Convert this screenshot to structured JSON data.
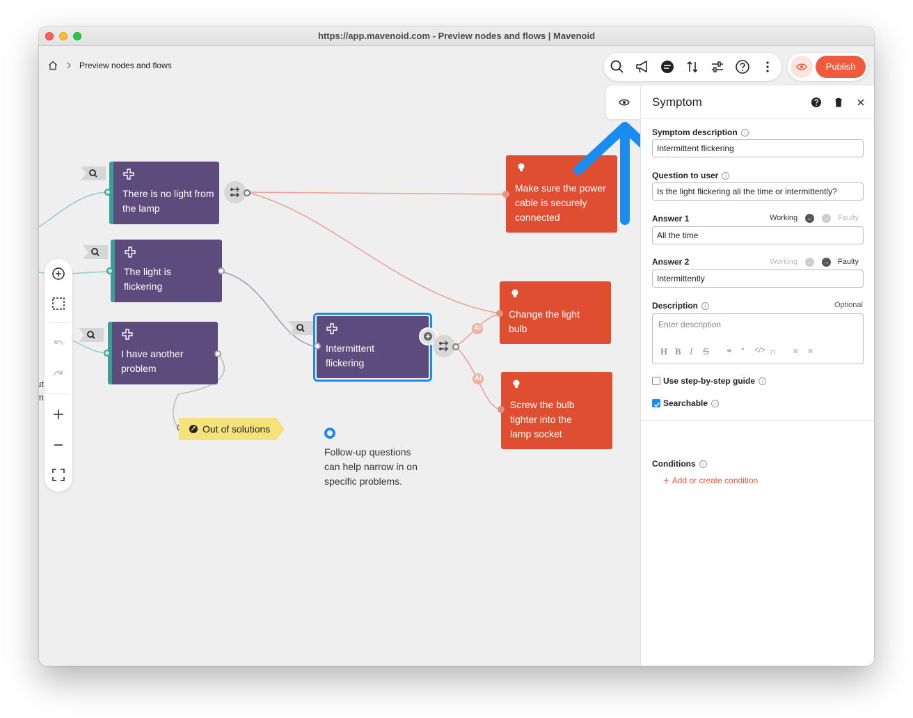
{
  "window": {
    "title": "https://app.mavenoid.com - Preview nodes and flows | Mavenoid"
  },
  "breadcrumb": {
    "home_icon": "home-icon",
    "current": "Preview nodes and flows"
  },
  "toolbar": {
    "icons": [
      "search-icon",
      "megaphone-icon",
      "chat-icon",
      "sort-icon",
      "sliders-icon",
      "help-icon",
      "more-icon"
    ],
    "preview_icon": "eye-icon",
    "publish_label": "Publish"
  },
  "colors": {
    "accent": "#f05a3c",
    "selection": "#1a8cf0",
    "symptom_node": "#5c4b7c",
    "solution_node": "#e04e31",
    "teal": "#3a9e94"
  },
  "flow": {
    "symptoms": [
      {
        "label": "There is no light from the lamp"
      },
      {
        "label": "The light is flickering"
      },
      {
        "label": "I have another problem"
      },
      {
        "label": "Intermittent flickering"
      }
    ],
    "solutions": [
      {
        "label": "Make sure the power cable is securely connected"
      },
      {
        "label": "Change the light bulb"
      },
      {
        "label": "Screw the bulb tighter into the lamp socket"
      }
    ],
    "out_of_solutions": "Out of solutions",
    "ai_badge": "AI",
    "hint": "Follow-up questions can help narrow in on specific problems.",
    "cut_text": [
      "ut",
      "m"
    ]
  },
  "panel": {
    "title": "Symptom",
    "symptom_description_label": "Symptom description",
    "symptom_description_value": "Intermittent flickering",
    "question_label": "Question to user",
    "question_value": "Is the light flickering all the time or intermittently?",
    "answer1_label": "Answer 1",
    "answer1_value": "All the time",
    "answer2_label": "Answer 2",
    "answer2_value": "Intermittently",
    "working_label": "Working",
    "faulty_label": "Faulty",
    "description_label": "Description",
    "optional_label": "Optional",
    "description_placeholder": "Enter description",
    "step_guide_label": "Use step-by-step guide",
    "step_guide_checked": false,
    "searchable_label": "Searchable",
    "searchable_checked": true,
    "conditions_label": "Conditions",
    "add_condition_label": "Add or create condition"
  }
}
